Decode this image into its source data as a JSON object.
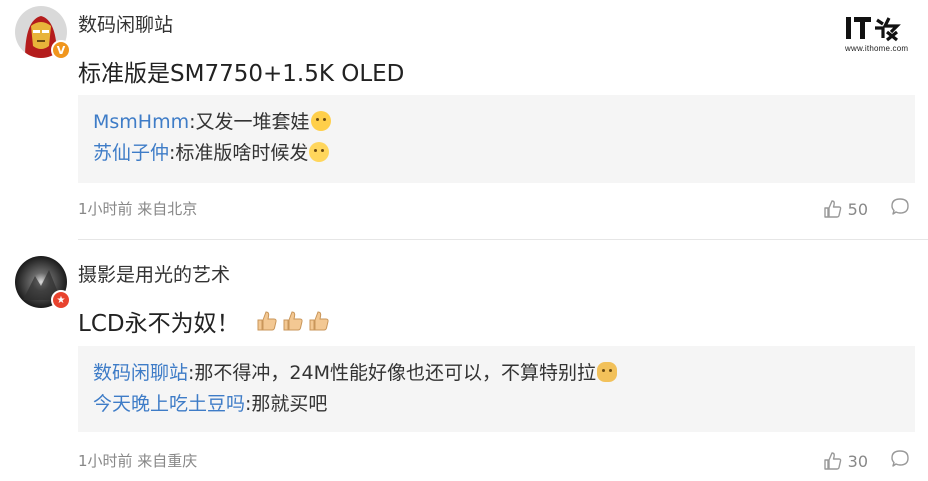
{
  "watermark": {
    "logo_text": "IT之家",
    "url": "www.ithome.com"
  },
  "comments": [
    {
      "username": "数码闲聊站",
      "badge": "V",
      "content": "标准版是SM7750+1.5K OLED",
      "replies": [
        {
          "user": "MsmHmm",
          "sep": ":",
          "text": "又发一堆套娃",
          "emoji": "smug-emoji"
        },
        {
          "user": "苏仙子仲",
          "sep": ":",
          "text": "标准版啥时候发",
          "emoji": "thinking-emoji"
        }
      ],
      "meta": "1小时前 来自北京",
      "likes": "50"
    },
    {
      "username": "摄影是用光的艺术",
      "badge": "★",
      "content": "LCD永不为奴！",
      "content_emojis": [
        "thumbs-up-emoji",
        "thumbs-up-emoji",
        "thumbs-up-emoji"
      ],
      "replies": [
        {
          "user": "数码闲聊站",
          "sep": ":",
          "text": "那不得冲，24M性能好像也还可以，不算特别拉",
          "emoji": "doge-emoji"
        },
        {
          "user": "今天晚上吃土豆吗",
          "sep": ":",
          "text": "那就买吧",
          "emoji": ""
        }
      ],
      "meta": "1小时前 来自重庆",
      "likes": "30"
    }
  ],
  "colors": {
    "reply_user": "#3e7cc7",
    "reply_bg": "#f5f5f5",
    "meta": "#888888",
    "badge_v": "#f0961e",
    "badge_star": "#e8432e"
  }
}
